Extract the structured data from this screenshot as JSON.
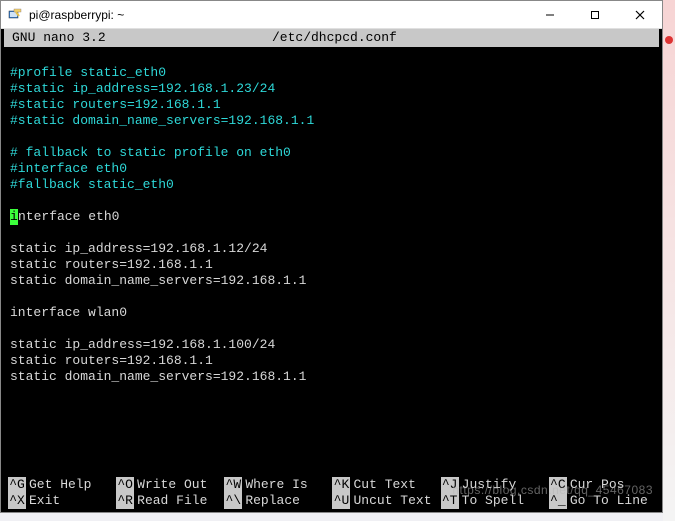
{
  "window": {
    "title": "pi@raspberrypi: ~"
  },
  "nano": {
    "app_label": "GNU nano 3.2",
    "file_path": "/etc/dhcpcd.conf"
  },
  "lines": [
    {
      "text": "",
      "class": "normal"
    },
    {
      "text": "#profile static_eth0",
      "class": "comment"
    },
    {
      "text": "#static ip_address=192.168.1.23/24",
      "class": "comment"
    },
    {
      "text": "#static routers=192.168.1.1",
      "class": "comment"
    },
    {
      "text": "#static domain_name_servers=192.168.1.1",
      "class": "comment"
    },
    {
      "text": "",
      "class": "normal"
    },
    {
      "text": "# fallback to static profile on eth0",
      "class": "comment"
    },
    {
      "text": "#interface eth0",
      "class": "comment"
    },
    {
      "text": "#fallback static_eth0",
      "class": "comment"
    },
    {
      "text": "",
      "class": "normal"
    },
    {
      "cursor_char": "i",
      "rest": "nterface eth0",
      "class": "normal"
    },
    {
      "text": "",
      "class": "normal"
    },
    {
      "text": "static ip_address=192.168.1.12/24",
      "class": "normal"
    },
    {
      "text": "static routers=192.168.1.1",
      "class": "normal"
    },
    {
      "text": "static domain_name_servers=192.168.1.1",
      "class": "normal"
    },
    {
      "text": "",
      "class": "normal"
    },
    {
      "text": "interface wlan0",
      "class": "normal"
    },
    {
      "text": "",
      "class": "normal"
    },
    {
      "text": "static ip_address=192.168.1.100/24",
      "class": "normal"
    },
    {
      "text": "static routers=192.168.1.1",
      "class": "normal"
    },
    {
      "text": "static domain_name_servers=192.168.1.1",
      "class": "normal"
    }
  ],
  "shortcuts": [
    {
      "key": "^G",
      "label": "Get Help"
    },
    {
      "key": "^O",
      "label": "Write Out"
    },
    {
      "key": "^W",
      "label": "Where Is"
    },
    {
      "key": "^K",
      "label": "Cut Text"
    },
    {
      "key": "^J",
      "label": "Justify"
    },
    {
      "key": "^C",
      "label": "Cur Pos"
    },
    {
      "key": "^X",
      "label": "Exit"
    },
    {
      "key": "^R",
      "label": "Read File"
    },
    {
      "key": "^\\",
      "label": "Replace"
    },
    {
      "key": "^U",
      "label": "Uncut Text"
    },
    {
      "key": "^T",
      "label": "To Spell"
    },
    {
      "key": "^_",
      "label": "Go To Line"
    }
  ],
  "watermark": "https://blog.csdn.net/qq_45467083"
}
